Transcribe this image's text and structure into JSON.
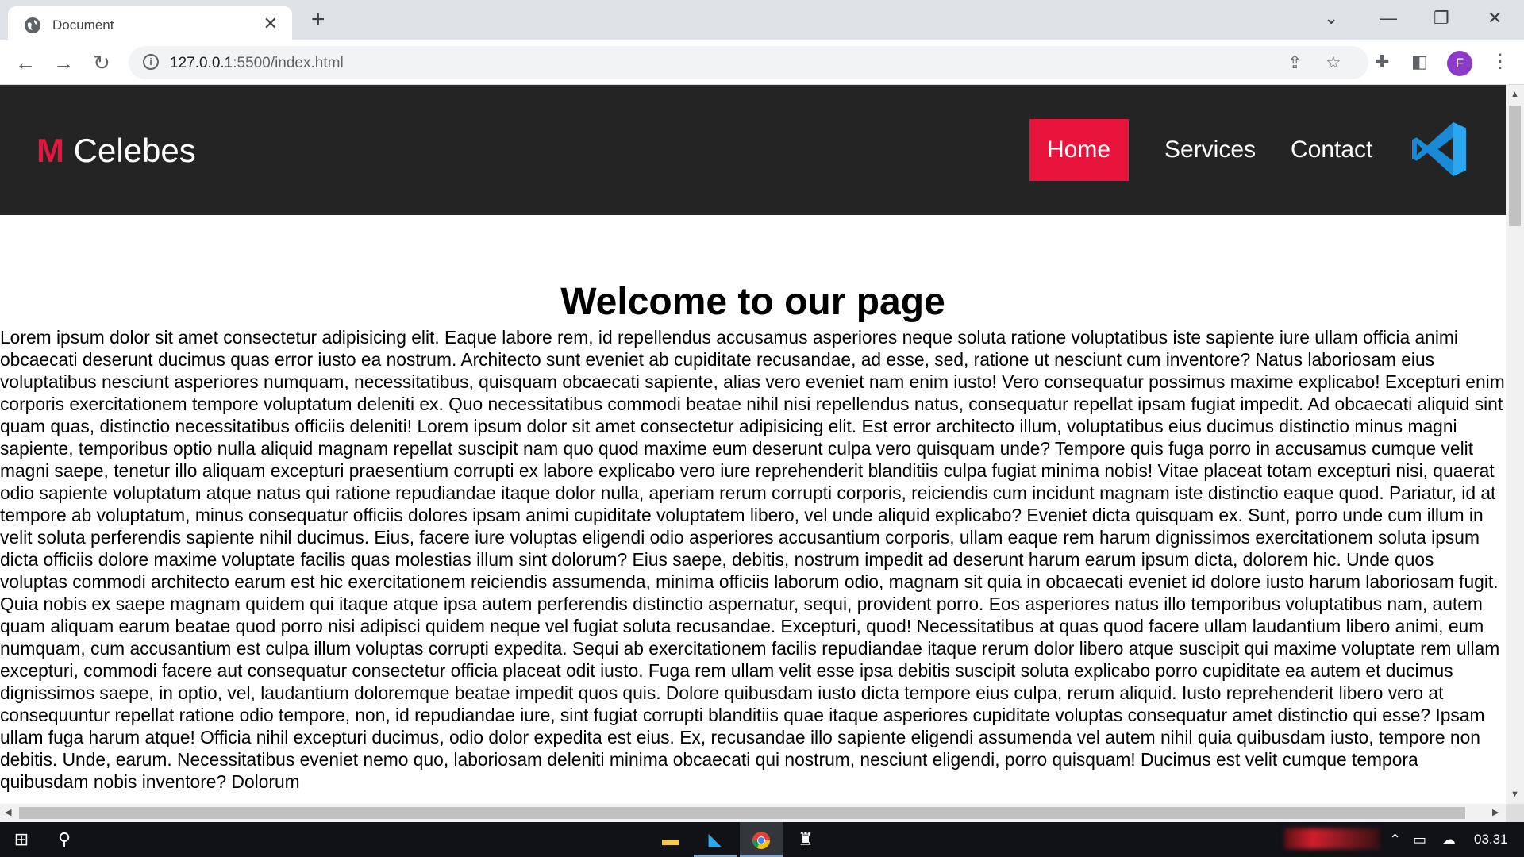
{
  "browser": {
    "tab_title": "Document",
    "url_host": "127.0.0.1",
    "url_path": ":5500/index.html",
    "profile_initial": "F",
    "accent_colors": {
      "profile": "#8e3ac9"
    }
  },
  "site": {
    "logo_mark": "M",
    "logo_text": "Celebes",
    "nav": [
      {
        "label": "Home",
        "active": true
      },
      {
        "label": "Services",
        "active": false
      },
      {
        "label": "Contact",
        "active": false
      }
    ],
    "brand_color": "#e8143c",
    "header_bg": "#242424"
  },
  "content": {
    "title": "Welcome to our page",
    "body": "Lorem ipsum dolor sit amet consectetur adipisicing elit. Eaque labore rem, id repellendus accusamus asperiores neque soluta ratione voluptatibus iste sapiente iure ullam officia animi obcaecati deserunt ducimus quas error iusto ea nostrum. Architecto sunt eveniet ab cupiditate recusandae, ad esse, sed, ratione ut nesciunt cum inventore? Natus laboriosam eius voluptatibus nesciunt asperiores numquam, necessitatibus, quisquam obcaecati sapiente, alias vero eveniet nam enim iusto! Vero consequatur possimus maxime explicabo! Excepturi enim corporis exercitationem tempore voluptatum deleniti ex. Quo necessitatibus commodi beatae nihil nisi repellendus natus, consequatur repellat ipsam fugiat impedit. Ad obcaecati aliquid sint quam quas, distinctio necessitatibus officiis deleniti! Lorem ipsum dolor sit amet consectetur adipisicing elit. Est error architecto illum, voluptatibus eius ducimus distinctio minus magni sapiente, temporibus optio nulla aliquid magnam repellat suscipit nam quo quod maxime eum deserunt culpa vero quisquam unde? Tempore quis fuga porro in accusamus cumque velit magni saepe, tenetur illo aliquam excepturi praesentium corrupti ex labore explicabo vero iure reprehenderit blanditiis culpa fugiat minima nobis! Vitae placeat totam excepturi nisi, quaerat odio sapiente voluptatum atque natus qui ratione repudiandae itaque dolor nulla, aperiam rerum corrupti corporis, reiciendis cum incidunt magnam iste distinctio eaque quod. Pariatur, id at tempore ab voluptatum, minus consequatur officiis dolores ipsam animi cupiditate voluptatem libero, vel unde aliquid explicabo? Eveniet dicta quisquam ex. Sunt, porro unde cum illum in velit soluta perferendis sapiente nihil ducimus. Eius, facere iure voluptas eligendi odio asperiores accusantium corporis, ullam eaque rem harum dignissimos exercitationem soluta ipsum dicta officiis dolore maxime voluptate facilis quas molestias illum sint dolorum? Eius saepe, debitis, nostrum impedit ad deserunt harum earum ipsum dicta, dolorem hic. Unde quos voluptas commodi architecto earum est hic exercitationem reiciendis assumenda, minima officiis laborum odio, magnam sit quia in obcaecati eveniet id dolore iusto harum laboriosam fugit. Quia nobis ex saepe magnam quidem qui itaque atque ipsa autem perferendis distinctio aspernatur, sequi, provident porro. Eos asperiores natus illo temporibus voluptatibus nam, autem quam aliquam earum beatae quod porro nisi adipisci quidem neque vel fugiat soluta recusandae. Excepturi, quod! Necessitatibus at quas quod facere ullam laudantium libero animi, eum numquam, cum accusantium est culpa illum voluptas corrupti expedita. Sequi ab exercitationem facilis repudiandae itaque rerum dolor libero atque suscipit qui maxime voluptate rem ullam excepturi, commodi facere aut consequatur consectetur officia placeat odit iusto. Fuga rem ullam velit esse ipsa debitis suscipit soluta explicabo porro cupiditate ea autem et ducimus dignissimos saepe, in optio, vel, laudantium doloremque beatae impedit quos quis. Dolore quibusdam iusto dicta tempore eius culpa, rerum aliquid. Iusto reprehenderit libero vero at consequuntur repellat ratione odio tempore, non, id repudiandae iure, sint fugiat corrupti blanditiis quae itaque asperiores cupiditate voluptas consequatur amet distinctio qui esse? Ipsam ullam fuga harum atque! Officia nihil excepturi ducimus, odio dolor expedita est eius. Ex, recusandae illo sapiente eligendi assumenda vel autem nihil quia quibusdam iusto, tempore non debitis. Unde, earum. Necessitatibus eveniet nemo quo, laboriosam deleniti minima obcaecati qui nostrum, nesciunt eligendi, porro quisquam! Ducimus est velit cumque tempora quibusdam nobis inventore? Dolorum"
  },
  "taskbar": {
    "clock": "03.31",
    "apps": [
      "file-explorer-icon",
      "vscode-icon",
      "chrome-icon",
      "app-icon"
    ]
  }
}
